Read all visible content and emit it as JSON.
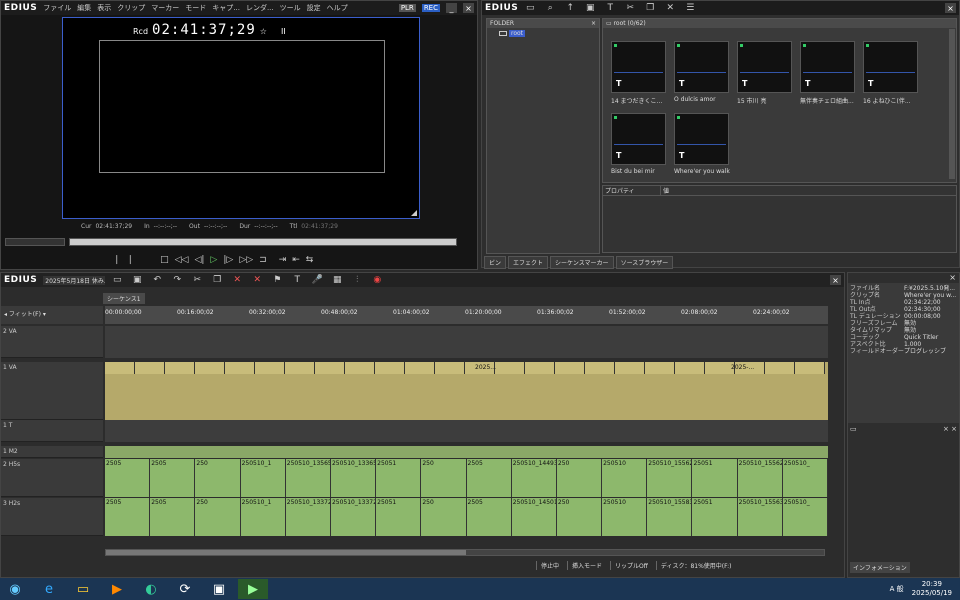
{
  "player": {
    "logo": "EDIUS",
    "menu": [
      "ファイル",
      "編集",
      "表示",
      "クリップ",
      "マーカー",
      "モード",
      "キャプ...",
      "レンダ...",
      "ツール",
      "設定",
      "ヘルプ"
    ],
    "plr": "PLR",
    "rec": "REC",
    "rcd_label": "Rcd",
    "timecode": "02:41:37;29",
    "cur_label": "Cur",
    "cur": "02:41:37;29",
    "in_label": "In",
    "in": "--:--:--;--",
    "out_label": "Out",
    "out": "--:--:--;--",
    "dur_label": "Dur",
    "dur": "--:--:--;--",
    "ttl_label": "Ttl",
    "ttl": "02:41:37;29"
  },
  "bin": {
    "logo": "EDIUS",
    "folder_header": "FOLDER",
    "root": "root",
    "root_count": "root (0/62)",
    "props_label": "プロパティ",
    "props_value": "値",
    "tabs": [
      "ビン",
      "エフェクト",
      "シーケンスマーカー",
      "ソースブラウザー"
    ],
    "clips": [
      "14 まつだきくこ...",
      "O dulcis amor",
      "15 市川 亮",
      "無伴奏チェロ組曲...",
      "16 よねひこ(伴...",
      "Bist du bei mir",
      "Where'er you walk"
    ]
  },
  "timeline": {
    "logo": "EDIUS",
    "date": "2025年5月18日 休み...",
    "seq_tab": "シーケンス1",
    "fit": "フィット(F)",
    "ruler": [
      "00:00:00;00",
      "00:16:00;02",
      "00:32:00;02",
      "00:48:00;02",
      "01:04:00;02",
      "01:20:00;00",
      "01:36:00;02",
      "01:52:00;02",
      "02:08:00;02",
      "02:24:00;02"
    ],
    "tracks": {
      "va2": "2 VA",
      "va1": "1 VA",
      "t1": "1 T",
      "m2": "1 M2",
      "h5s": "2 H5s",
      "h2s": "3 H2s"
    },
    "clip_labels_a": [
      "2505",
      "2505",
      "250",
      "250510_1",
      "250510_135656...",
      "250510_13365...",
      "25051",
      "250",
      "2505",
      "250510_144939...",
      "250",
      "250510",
      "250510_15562...",
      "25051",
      "250510_155629_Mi...",
      "250510_"
    ],
    "clip_labels_b": [
      "2505",
      "2505",
      "250",
      "250510_1",
      "250510_133725...",
      "250510_13372...",
      "25051",
      "250",
      "2505",
      "250510_145011...",
      "250",
      "250510",
      "250510_15583...",
      "25051",
      "250510_155639_FR...",
      "250510_"
    ],
    "v1_labels": [
      "2025...",
      "2025-..."
    ],
    "status": [
      "停止中",
      "挿入モード",
      "リップルOff",
      "ディスク：81%使用中(F:)"
    ]
  },
  "info": {
    "tab": "インフォメーション",
    "rows": [
      [
        "ファイル名",
        "F:¥2025.5.10発..."
      ],
      [
        "クリップ名",
        "Where'er you w..."
      ],
      [
        "TL In点",
        "02:34:22;00"
      ],
      [
        "TL Out点",
        "02:34:30;00"
      ],
      [
        "TL デュレーション",
        "00:00:08;00"
      ],
      [
        "フリーズフレーム",
        "無効"
      ],
      [
        "タイムリマップ",
        "無効"
      ],
      [
        "コーデック",
        "Quick Titler"
      ],
      [
        "アスペクト比",
        "1.000"
      ],
      [
        "フィールドオーダー",
        "プログレッシブ"
      ]
    ]
  },
  "taskbar": {
    "ime": "A 般",
    "time": "20:39",
    "date": "2025/05/19"
  }
}
